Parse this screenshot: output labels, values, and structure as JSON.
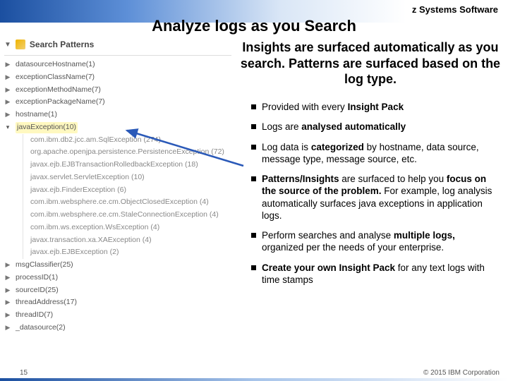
{
  "brand": "z Systems Software",
  "title": "Analyze logs as you Search",
  "subtitle": "Insights are surfaced automatically as you search.  Patterns are surfaced based on the log type.",
  "panel_header": "Search Patterns",
  "tree": {
    "top": [
      {
        "label": "datasourceHostname(1)"
      },
      {
        "label": "exceptionClassName(7)"
      },
      {
        "label": "exceptionMethodName(7)"
      },
      {
        "label": "exceptionPackageName(7)"
      },
      {
        "label": "hostname(1)"
      }
    ],
    "expanded_label": "javaException(10)",
    "expanded_children": [
      "com.ibm.db2.jcc.am.SqlException (274)",
      "org.apache.openjpa.persistence.PersistenceException (72)",
      "javax.ejb.EJBTransactionRolledbackException (18)",
      "javax.servlet.ServletException (10)",
      "javax.ejb.FinderException (6)",
      "com.ibm.websphere.ce.cm.ObjectClosedException (4)",
      "com.ibm.websphere.ce.cm.StaleConnectionException (4)",
      "com.ibm.ws.exception.WsException (4)",
      "javax.transaction.xa.XAException (4)",
      "javax.ejb.EJBException (2)"
    ],
    "bottom": [
      {
        "label": "msgClassifier(25)"
      },
      {
        "label": "processID(1)"
      },
      {
        "label": "sourceID(25)"
      },
      {
        "label": "threadAddress(17)"
      },
      {
        "label": "threadID(7)"
      },
      {
        "label": "_datasource(2)"
      }
    ]
  },
  "bullets": [
    {
      "pre": "Provided with every ",
      "bold": "Insight Pack",
      "post": ""
    },
    {
      "pre": "Logs are ",
      "bold": "analysed automatically",
      "post": ""
    },
    {
      "pre": "Log data is ",
      "bold": "categorized",
      "post": " by hostname, data source, message type, message source, etc."
    },
    {
      "pre": "",
      "bold": "Patterns/Insights",
      "post": " are surfaced to help you ",
      "bold2": "focus on the source of the problem.",
      "post2": " For example, log analysis automatically surfaces java exceptions in application logs."
    },
    {
      "pre": "Perform searches and analyse ",
      "bold": "multiple logs,",
      "post": " organized per the needs of your enterprise."
    },
    {
      "pre": "",
      "bold": "Create your own Insight Pack",
      "post": " for any text logs with time stamps"
    }
  ],
  "page_number": "15",
  "copyright": "© 2015 IBM Corporation"
}
